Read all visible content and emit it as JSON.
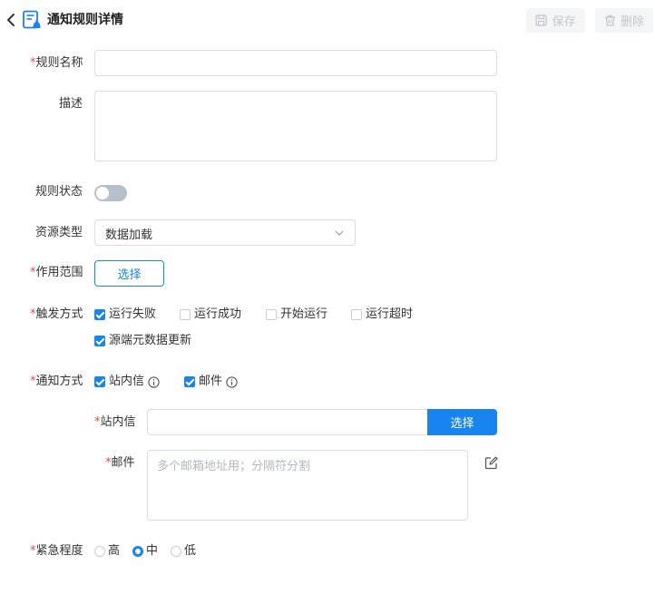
{
  "header": {
    "title": "通知规则详情",
    "save_label": "保存",
    "delete_label": "删除"
  },
  "form": {
    "required_mark": "*",
    "rule_name_label": "规则名称",
    "rule_name_value": "",
    "description_label": "描述",
    "description_value": "",
    "rule_status_label": "规则状态",
    "rule_status_on": false,
    "resource_type_label": "资源类型",
    "resource_type_value": "数据加载",
    "scope_label": "作用范围",
    "scope_button": "选择",
    "trigger_label": "触发方式",
    "triggers": [
      {
        "label": "运行失败",
        "checked": true
      },
      {
        "label": "运行成功",
        "checked": false
      },
      {
        "label": "开始运行",
        "checked": false
      },
      {
        "label": "运行超时",
        "checked": false
      },
      {
        "label": "源端元数据更新",
        "checked": true
      }
    ],
    "notify_label": "通知方式",
    "notify_methods": [
      {
        "label": "站内信",
        "checked": true
      },
      {
        "label": "邮件",
        "checked": true
      }
    ],
    "site_msg_label": "站内信",
    "site_msg_value": "",
    "site_msg_button": "选择",
    "mail_label": "邮件",
    "mail_placeholder": "多个邮箱地址用；分隔符分割",
    "urgency_label": "紧急程度",
    "urgency_options": [
      {
        "label": "高",
        "selected": false
      },
      {
        "label": "中",
        "selected": true
      },
      {
        "label": "低",
        "selected": false
      }
    ]
  },
  "colors": {
    "accent": "#1784f0",
    "required": "#e34d4d",
    "border": "#d9dce1"
  }
}
